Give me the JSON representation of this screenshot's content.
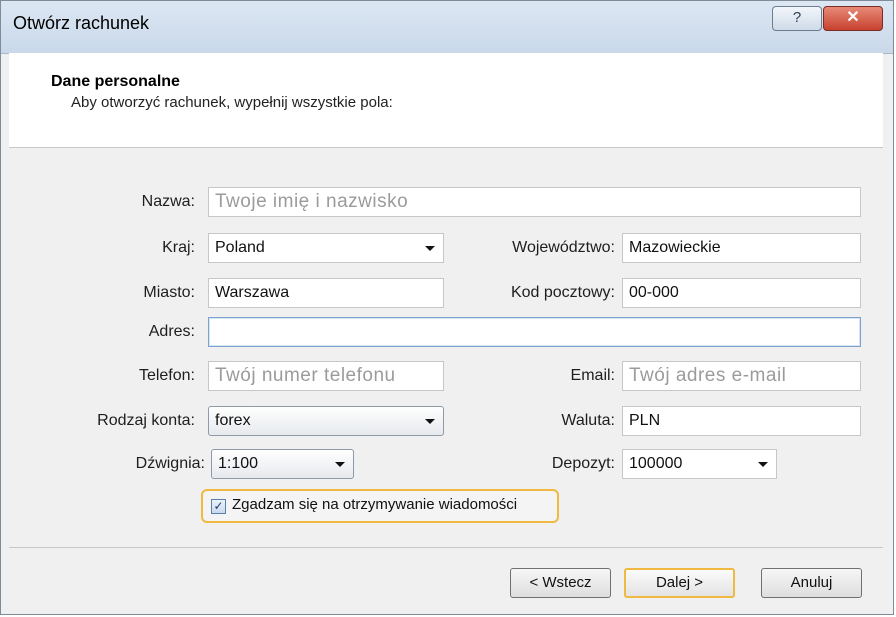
{
  "window": {
    "title": "Otwórz rachunek",
    "help_glyph": "?",
    "close_glyph": "✕"
  },
  "header": {
    "title": "Dane personalne",
    "subtitle": "Aby otworzyć rachunek, wypełnij wszystkie pola:"
  },
  "form": {
    "name_label": "Nazwa:",
    "name_placeholder": "Twoje imię i nazwisko",
    "country_label": "Kraj:",
    "country_value": "Poland",
    "province_label": "Województwo:",
    "province_value": "Mazowieckie",
    "city_label": "Miasto:",
    "city_value": "Warszawa",
    "postal_label": "Kod pocztowy:",
    "postal_value": "00-000",
    "address_label": "Adres:",
    "address_value": "",
    "phone_label": "Telefon:",
    "phone_placeholder": "Twój numer telefonu",
    "email_label": "Email:",
    "email_placeholder": "Twój adres e-mail",
    "account_type_label": "Rodzaj konta:",
    "account_type_value": "forex",
    "currency_label": "Waluta:",
    "currency_value": "PLN",
    "leverage_label": "Dźwignia:",
    "leverage_value": "1:100",
    "deposit_label": "Depozyt:",
    "deposit_value": "100000",
    "consent_label": "Zgadzam się na otrzymywanie wiadomości",
    "consent_checked": true
  },
  "buttons": {
    "back": "< Wstecz",
    "next": "Dalej >",
    "cancel": "Anuluj"
  },
  "colors": {
    "focus_highlight": "#f0b942",
    "titlebar": "#c9d8e9",
    "close_button": "#c8412f"
  }
}
